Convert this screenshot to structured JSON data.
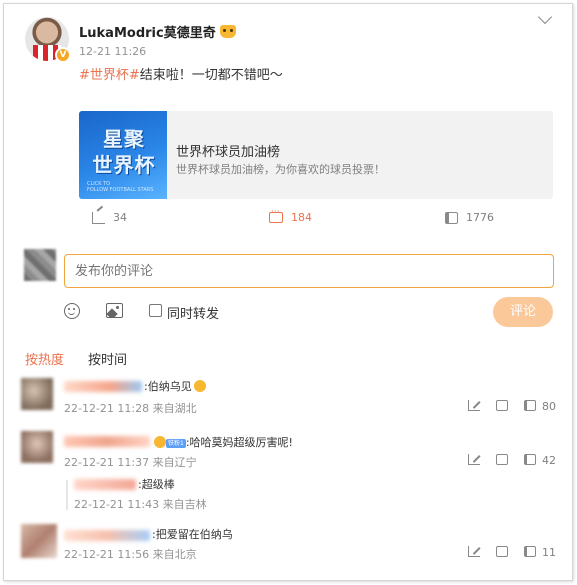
{
  "post": {
    "username": "LukaModric莫德里奇",
    "verified_badge": "V",
    "time": "12-21 11:26",
    "hashtag": "#世界杯#",
    "text": "结束啦！一切都不错吧～",
    "card": {
      "image_line1": "星聚",
      "image_line2": "世界杯",
      "image_small1": "CLICK TO",
      "image_small2": "FOLLOW FOOTBALL STARS",
      "title": "世界杯球员加油榜",
      "desc": "世界杯球员加油榜，为你喜欢的球员投票！"
    },
    "actions": {
      "share_count": "34",
      "comment_count": "184",
      "like_count": "1776"
    }
  },
  "composer": {
    "placeholder": "发布你的评论",
    "forward_label": "同时转发",
    "submit_label": "评论"
  },
  "tabs": [
    {
      "label": "按热度",
      "active": true
    },
    {
      "label": "按时间",
      "active": false
    }
  ],
  "comments": [
    {
      "text": ":伯纳乌见",
      "meta": "22-12-21 11:28 来自湖北",
      "likes": "80"
    },
    {
      "badge": "铁粉1",
      "text": ":哈哈莫妈超级厉害呢!",
      "meta": "22-12-21 11:37 来自辽宁",
      "likes": "42",
      "reply": {
        "text": ":超级棒",
        "meta": "22-12-21 11:43 来自吉林"
      }
    },
    {
      "text": ":把爱留在伯纳乌",
      "meta": "22-12-21 11:56 来自北京",
      "likes": "11"
    }
  ],
  "colors": {
    "accent": "#eb7350",
    "input_border": "#f2a53d",
    "submit_bg": "#fbc89a"
  }
}
